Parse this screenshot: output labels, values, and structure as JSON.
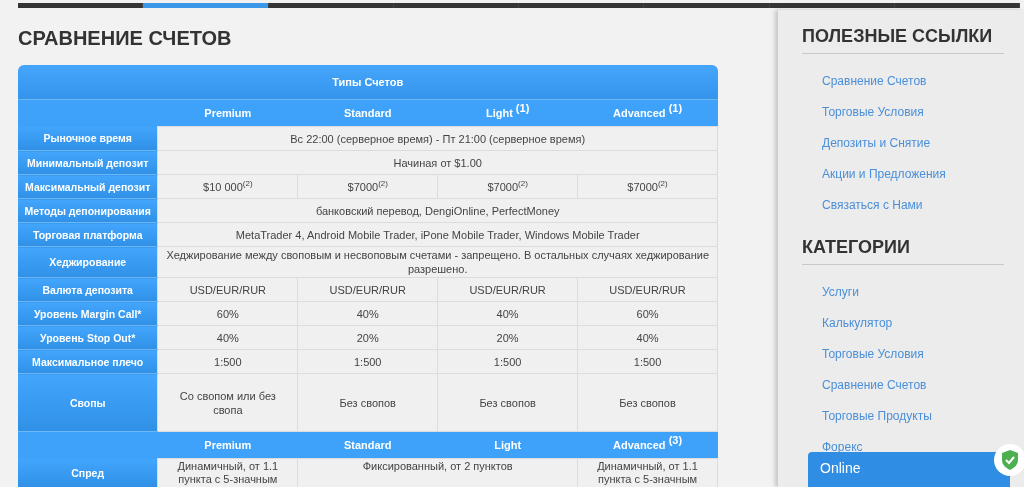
{
  "nav_bar": {
    "segments": [
      {
        "selected": false
      },
      {
        "selected": true
      },
      {
        "selected": false
      },
      {
        "selected": false
      },
      {
        "selected": false
      },
      {
        "selected": false
      },
      {
        "selected": false
      },
      {
        "selected": false
      }
    ]
  },
  "page_title": "СРАВНЕНИЕ СЧЕТОВ",
  "table": {
    "title": "Типы Счетов",
    "sections": [
      {
        "columns": [
          "Premium",
          "Standard",
          "Light $^{(1)}$",
          "Advanced $^{(1)}$"
        ],
        "rows": [
          {
            "label": "Рыночное время",
            "cells": [
              {
                "text": "Вс 22:00 (серверное время) - Пт 21:00 (серверное время)",
                "colspan": 4
              }
            ]
          },
          {
            "label": "Минимальный депозит",
            "cells": [
              {
                "text": "Начиная от $1.00",
                "colspan": 4
              }
            ]
          },
          {
            "label": "Максимальный депозит",
            "cells": [
              {
                "text": "$10 000$^{(2)}$"
              },
              {
                "text": "$7000$^{(2)}$"
              },
              {
                "text": "$7000$^{(2)}$"
              },
              {
                "text": "$7000$^{(2)}$"
              }
            ]
          },
          {
            "label": "Методы депонирования",
            "cells": [
              {
                "text": "банковский перевод, DengiOnline, PerfectMoney",
                "colspan": 4
              }
            ]
          },
          {
            "label": "Торговая платформа",
            "cells": [
              {
                "text": "MetaTrader 4, Android Mobile Trader, iPone Mobile Trader, Windows Mobile Trader",
                "colspan": 4
              }
            ]
          },
          {
            "label": "Хеджирование",
            "cells": [
              {
                "text": "Хеджирование между своповым и несвоповым счетами - запрещено. В остальных случаях хеджирование разрешено.",
                "colspan": 4
              }
            ]
          },
          {
            "label": "Валюта депозита",
            "cells": [
              {
                "text": "USD/EUR/RUR"
              },
              {
                "text": "USD/EUR/RUR"
              },
              {
                "text": "USD/EUR/RUR"
              },
              {
                "text": "USD/EUR/RUR"
              }
            ]
          },
          {
            "label": "Уровень Margin Call*",
            "cells": [
              {
                "text": "60%"
              },
              {
                "text": "40%"
              },
              {
                "text": "40%"
              },
              {
                "text": "60%"
              }
            ]
          },
          {
            "label": "Уровень Stop Out*",
            "cells": [
              {
                "text": "40%"
              },
              {
                "text": "20%"
              },
              {
                "text": "20%"
              },
              {
                "text": "40%"
              }
            ]
          },
          {
            "label": "Максимальное плечо",
            "cells": [
              {
                "text": "1:500"
              },
              {
                "text": "1:500"
              },
              {
                "text": "1:500"
              },
              {
                "text": "1:500"
              }
            ]
          },
          {
            "label": "Свопы",
            "cells": [
              {
                "text": "Со свопом или без свопа"
              },
              {
                "text": "Без свопов"
              },
              {
                "text": "Без свопов"
              },
              {
                "text": "Без свопов"
              }
            ]
          }
        ]
      },
      {
        "columns": [
          "Premium",
          "Standard",
          "Light",
          "Advanced $^{(3)}$"
        ],
        "rows": [
          {
            "label": "Спред",
            "cells": [
              {
                "text": "Динамичный, от 1.1 пункта с 5-значным"
              },
              {
                "text": "Фиксированный, от 2 пунктов",
                "colspan": 2
              },
              {
                "text": "Динамичный, от 1.1 пункта с 5-значным"
              }
            ]
          }
        ]
      }
    ]
  },
  "sidebar": {
    "sections": [
      {
        "heading": "ПОЛЕЗНЫЕ ССЫЛКИ",
        "links": [
          "Сравнение Счетов",
          "Торговые Условия",
          "Депозиты и Снятие",
          "Акции и Предложения",
          "Связаться с Нами"
        ]
      },
      {
        "heading": "КАТЕГОРИИ",
        "links": [
          "Услуги",
          "Калькулятор",
          "Торговые Условия",
          "Сравнение Счетов",
          "Торговые Продукты",
          "Форекс"
        ]
      }
    ]
  },
  "chat_widget": {
    "label": "Online"
  }
}
